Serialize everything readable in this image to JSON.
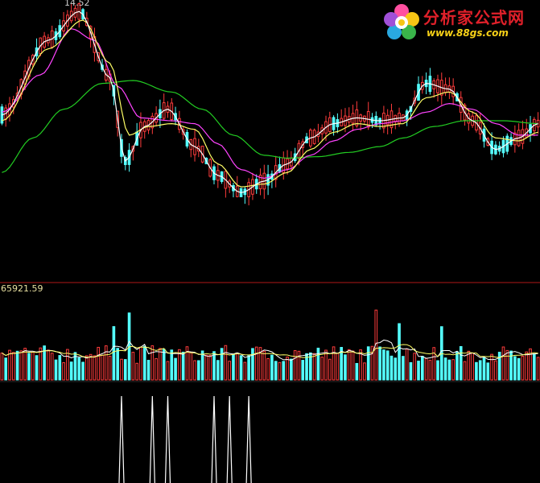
{
  "watermark": {
    "title": "分析家公式网",
    "url": "www.88gs.com"
  },
  "colors": {
    "background": "#000000",
    "up": "#ff3c3c",
    "down": "#54ffff",
    "ma_short": "#ffffff",
    "ma_mid": "#ffff66",
    "ma_long": "#ff44ff",
    "ma_longest": "#22cc22",
    "divider": "#b01818",
    "signal": "#ffffff"
  },
  "chart_data": [
    {
      "type": "candlestick",
      "panel": "price",
      "high_label": "14.52",
      "ylim": [
        6.8,
        15.2
      ],
      "candles_count": 140,
      "ma_anchors": {
        "ma_short": [
          [
            0,
            11.2
          ],
          [
            12,
            13.8
          ],
          [
            20,
            14.8
          ],
          [
            28,
            12.5
          ],
          [
            32,
            9.6
          ],
          [
            37,
            10.8
          ],
          [
            43,
            11.4
          ],
          [
            50,
            10.1
          ],
          [
            56,
            9.1
          ],
          [
            62,
            8.5
          ],
          [
            68,
            8.9
          ],
          [
            74,
            9.5
          ],
          [
            80,
            10.4
          ],
          [
            86,
            10.9
          ],
          [
            92,
            11.1
          ],
          [
            98,
            11.0
          ],
          [
            104,
            11.1
          ],
          [
            110,
            12.3
          ],
          [
            116,
            12.1
          ],
          [
            122,
            11.0
          ],
          [
            128,
            10.0
          ],
          [
            134,
            10.4
          ],
          [
            139,
            10.9
          ]
        ],
        "ma_mid": [
          [
            0,
            11.0
          ],
          [
            12,
            13.5
          ],
          [
            21,
            14.5
          ],
          [
            28,
            13.0
          ],
          [
            33,
            10.5
          ],
          [
            38,
            10.8
          ],
          [
            44,
            10.9
          ],
          [
            50,
            10.7
          ],
          [
            56,
            9.5
          ],
          [
            62,
            8.7
          ],
          [
            68,
            8.8
          ],
          [
            74,
            9.2
          ],
          [
            80,
            10.0
          ],
          [
            86,
            10.6
          ],
          [
            92,
            10.9
          ],
          [
            98,
            10.8
          ],
          [
            104,
            10.9
          ],
          [
            110,
            11.8
          ],
          [
            116,
            12.0
          ],
          [
            122,
            11.3
          ],
          [
            128,
            10.4
          ],
          [
            134,
            10.3
          ],
          [
            139,
            10.6
          ]
        ],
        "ma_long": [
          [
            0,
            11.3
          ],
          [
            10,
            12.6
          ],
          [
            18,
            14.2
          ],
          [
            24,
            13.8
          ],
          [
            30,
            12.2
          ],
          [
            36,
            11.1
          ],
          [
            44,
            11.0
          ],
          [
            50,
            10.9
          ],
          [
            56,
            10.2
          ],
          [
            62,
            9.3
          ],
          [
            68,
            9.0
          ],
          [
            74,
            9.3
          ],
          [
            80,
            9.8
          ],
          [
            86,
            10.3
          ],
          [
            92,
            10.7
          ],
          [
            98,
            10.9
          ],
          [
            104,
            11.0
          ],
          [
            110,
            11.3
          ],
          [
            116,
            11.6
          ],
          [
            122,
            11.4
          ],
          [
            128,
            10.9
          ],
          [
            134,
            10.5
          ],
          [
            139,
            10.5
          ]
        ],
        "ma_longest": [
          [
            0,
            9.2
          ],
          [
            8,
            10.4
          ],
          [
            16,
            11.4
          ],
          [
            26,
            12.3
          ],
          [
            34,
            12.4
          ],
          [
            44,
            12.0
          ],
          [
            52,
            11.4
          ],
          [
            60,
            10.5
          ],
          [
            68,
            9.8
          ],
          [
            74,
            9.7
          ],
          [
            82,
            9.75
          ],
          [
            90,
            9.9
          ],
          [
            98,
            10.1
          ],
          [
            104,
            10.4
          ],
          [
            112,
            10.8
          ],
          [
            120,
            11.0
          ],
          [
            130,
            11.0
          ],
          [
            139,
            10.9
          ]
        ]
      }
    },
    {
      "type": "bar",
      "panel": "volume",
      "max_label": "65921.59",
      "ylim": [
        0,
        65921.59
      ],
      "bars_count": 140
    },
    {
      "type": "signal",
      "panel": "indicator",
      "signals_at": [
        31,
        39,
        43,
        55,
        59,
        64
      ]
    }
  ]
}
